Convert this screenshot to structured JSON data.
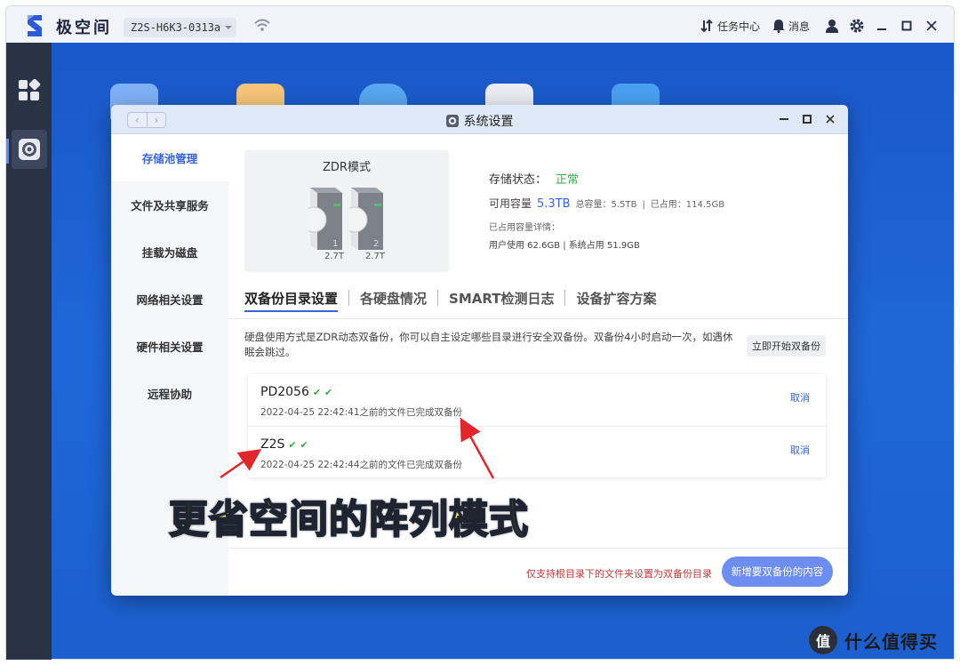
{
  "app": {
    "name": "极空间",
    "device_name": "Z2S-H6K3-0313a",
    "top_actions": {
      "tasks": "任务中心",
      "messages": "消息"
    }
  },
  "window": {
    "title": "系统设置"
  },
  "left_nav": {
    "items": [
      {
        "label": "存储池管理",
        "active": true
      },
      {
        "label": "文件及共享服务",
        "active": false
      },
      {
        "label": "挂载为磁盘",
        "active": false
      },
      {
        "label": "网络相关设置",
        "active": false
      },
      {
        "label": "硬件相关设置",
        "active": false
      },
      {
        "label": "远程协助",
        "active": false
      }
    ]
  },
  "storage": {
    "mode": "ZDR模式",
    "disks": [
      {
        "index": "1",
        "size": "2.7T"
      },
      {
        "index": "2",
        "size": "2.7T"
      }
    ],
    "status_label": "存储状态：",
    "status_value": "正常",
    "available_label": "可用容量",
    "available_value": "5.3TB",
    "total_text": "总容量：5.5TB",
    "used_text": "已占用：114.5GB",
    "detail_label": "已占用容量详情：",
    "user_used": "用户使用 62.6GB",
    "system_used": "系统占用 51.9GB"
  },
  "tabs": [
    {
      "label": "双备份目录设置",
      "active": true
    },
    {
      "label": "各硬盘情况",
      "active": false
    },
    {
      "label": "SMART检测日志",
      "active": false
    },
    {
      "label": "设备扩容方案",
      "active": false
    }
  ],
  "description": "硬盘使用方式是ZDR动态双备份，你可以自主设定哪些目录进行安全双备份。双备份4小时启动一次，如遇休眠会跳过。",
  "start_backup_label": "立即开始双备份",
  "backups": [
    {
      "name": "PD2056",
      "status": "2022-04-25 22:42:41之前的文件已完成双备份",
      "cancel": "取消"
    },
    {
      "name": "Z2S",
      "status": "2022-04-25 22:42:44之前的文件已完成双备份",
      "cancel": "取消"
    }
  ],
  "footer": {
    "note": "仅支持根目录下的文件夹设置为双备份目录",
    "add_button": "新增要双备份的内容"
  },
  "annotation": {
    "caption": "更省空间的阵列模式"
  },
  "watermark": {
    "logo_char": "值",
    "text": "什么值得买"
  },
  "colors": {
    "accent": "#3a63d8",
    "ok_green": "#3aa84a",
    "warning_red": "#c53a3a",
    "desktop_blue": "#1f67d8",
    "caption_yellow": "#ffe61c"
  }
}
